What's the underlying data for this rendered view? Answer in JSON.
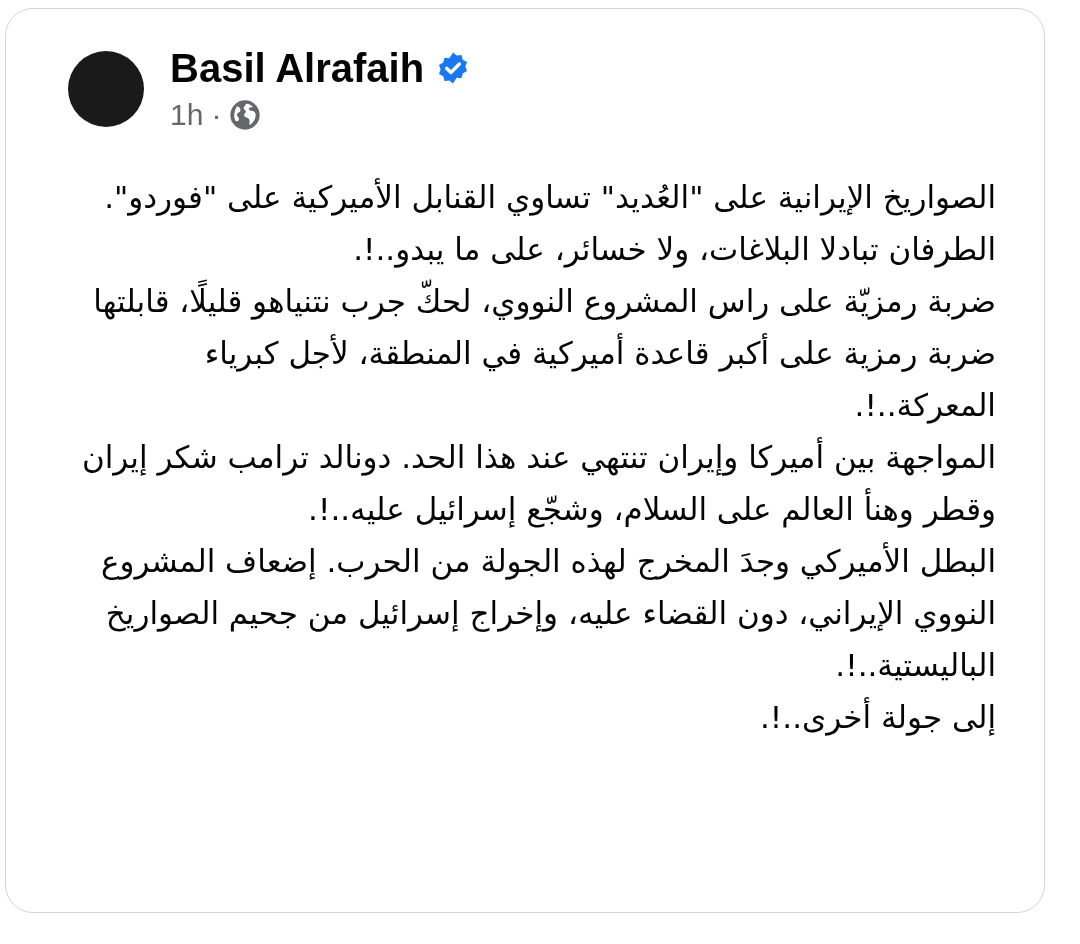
{
  "post": {
    "author": "Basil Alrafaih",
    "verified": true,
    "time": "1h",
    "separator": "·",
    "paragraphs": [
      "الصواريخ الإيرانية على \"العُديد\" تساوي القنابل الأميركية على \"فوردو\". الطرفان تبادلا البلاغات، ولا خسائر، على ما يبدو..!.",
      "ضربة رمزيّة على راس المشروع النووي، لحكّ جرب نتنياهو قليلًا، قابلتها ضربة رمزية على أكبر قاعدة أميركية في المنطقة، لأجل كبرياء المعركة..!.",
      "المواجهة بين أميركا وإيران تنتهي عند هذا الحد. دونالد ترامب شكر إيران وقطر وهنأ العالم على السلام، وشجّع إسرائيل عليه..!.",
      "البطل الأميركي وجدَ المخرج لهذه الجولة من الحرب. إضعاف المشروع النووي الإيراني، دون القضاء عليه، وإخراج إسرائيل من جحيم الصواريخ الباليستية..!.",
      "إلى جولة أخرى..!."
    ]
  }
}
